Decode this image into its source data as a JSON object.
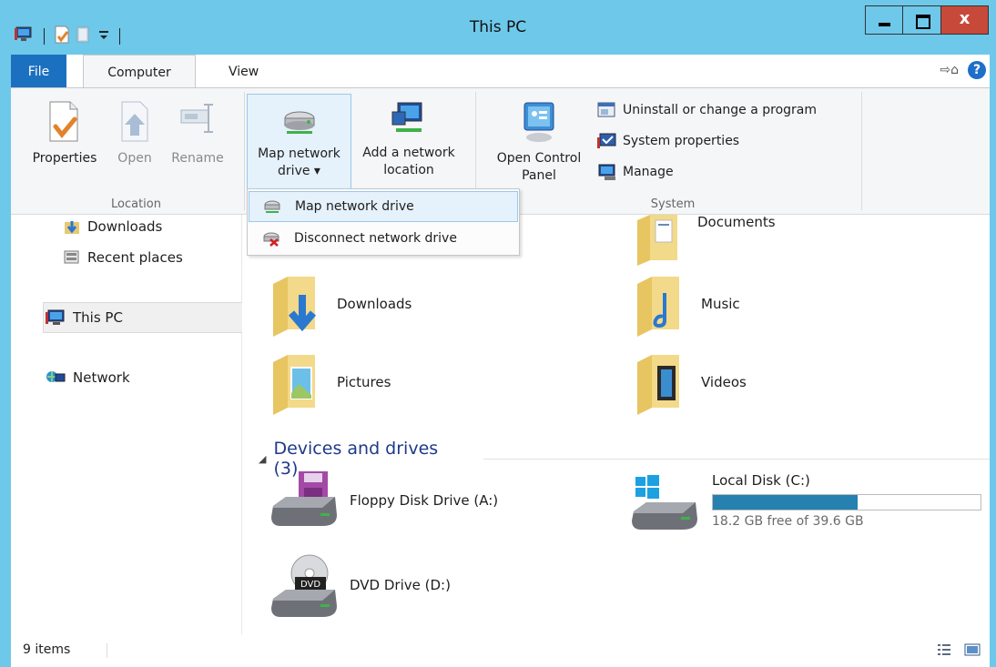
{
  "window": {
    "title": "This PC"
  },
  "tabs": {
    "file": "File",
    "computer": "Computer",
    "view": "View"
  },
  "ribbon": {
    "location": {
      "label": "Location",
      "properties": "Properties",
      "open": "Open",
      "rename": "Rename"
    },
    "network": {
      "map_line1": "Map network",
      "map_line2": "drive ▾",
      "add_line1": "Add a network",
      "add_line2": "location"
    },
    "control": {
      "line1": "Open Control",
      "line2": "Panel"
    },
    "system": {
      "label": "System",
      "uninstall": "Uninstall or change a program",
      "properties": "System properties",
      "manage": "Manage"
    }
  },
  "dropdown": {
    "items": [
      "Map network drive",
      "Disconnect network drive"
    ]
  },
  "nav": {
    "items": [
      "Downloads",
      "Recent places",
      "This PC",
      "Network"
    ]
  },
  "folders": [
    "Documents",
    "Downloads",
    "Music",
    "Pictures",
    "Videos"
  ],
  "devices": {
    "header": "Devices and drives (3)",
    "floppy": "Floppy Disk Drive (A:)",
    "local": {
      "name": "Local Disk (C:)",
      "free": "18.2 GB free of 39.6 GB",
      "used_fraction": 0.54
    },
    "dvd": "DVD Drive (D:)"
  },
  "status": {
    "count": "9 items"
  },
  "colors": {
    "accent": "#1c70c0",
    "titlebar": "#6ec8ea",
    "close": "#c7493a",
    "capacity": "#2680b0"
  }
}
